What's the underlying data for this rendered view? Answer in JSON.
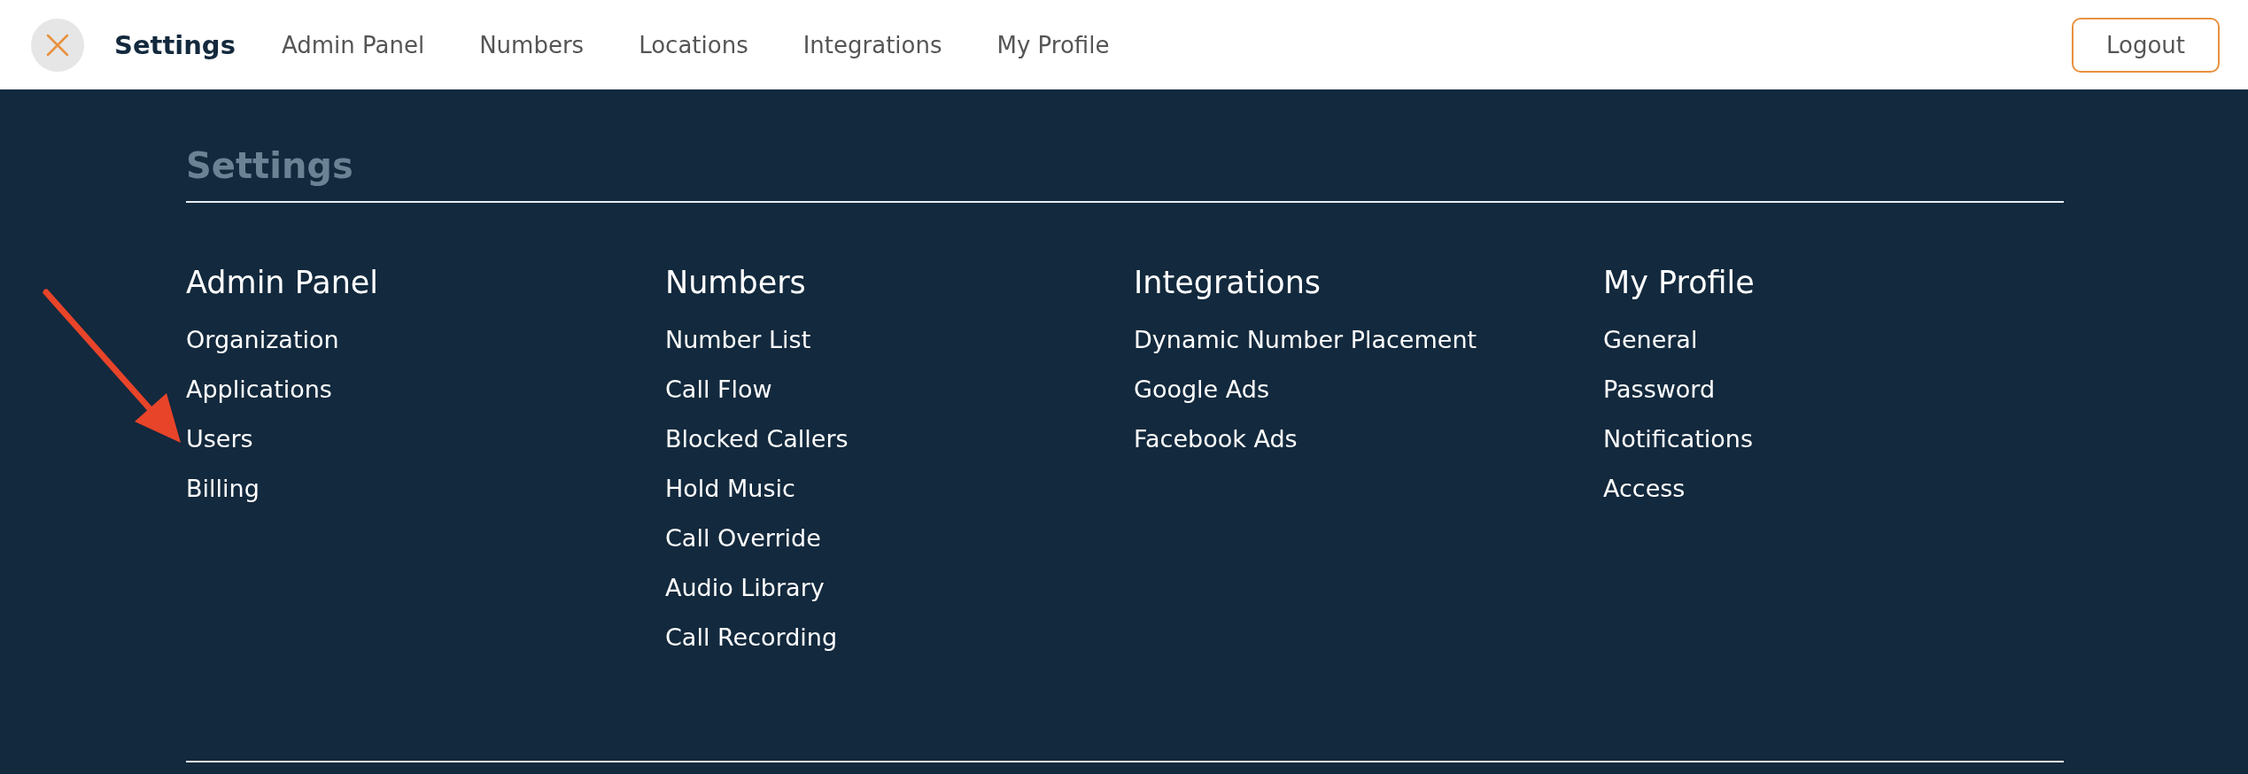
{
  "top_nav": {
    "items": [
      {
        "label": "Settings",
        "selected": true
      },
      {
        "label": "Admin Panel",
        "selected": false
      },
      {
        "label": "Numbers",
        "selected": false
      },
      {
        "label": "Locations",
        "selected": false
      },
      {
        "label": "Integrations",
        "selected": false
      },
      {
        "label": "My Profile",
        "selected": false
      }
    ],
    "logout_button": "Logout"
  },
  "menu": {
    "title": "Settings",
    "columns": [
      {
        "heading": "Admin Panel",
        "items": [
          "Organization",
          "Applications",
          "Users",
          "Billing"
        ]
      },
      {
        "heading": "Numbers",
        "items": [
          "Number List",
          "Call Flow",
          "Blocked Callers",
          "Hold Music",
          "Call Override",
          "Audio Library",
          "Call Recording"
        ]
      },
      {
        "heading": "Integrations",
        "items": [
          "Dynamic Number Placement",
          "Google Ads",
          "Facebook Ads"
        ]
      },
      {
        "heading": "My Profile",
        "items": [
          "General",
          "Password",
          "Notifications",
          "Access"
        ]
      }
    ]
  }
}
